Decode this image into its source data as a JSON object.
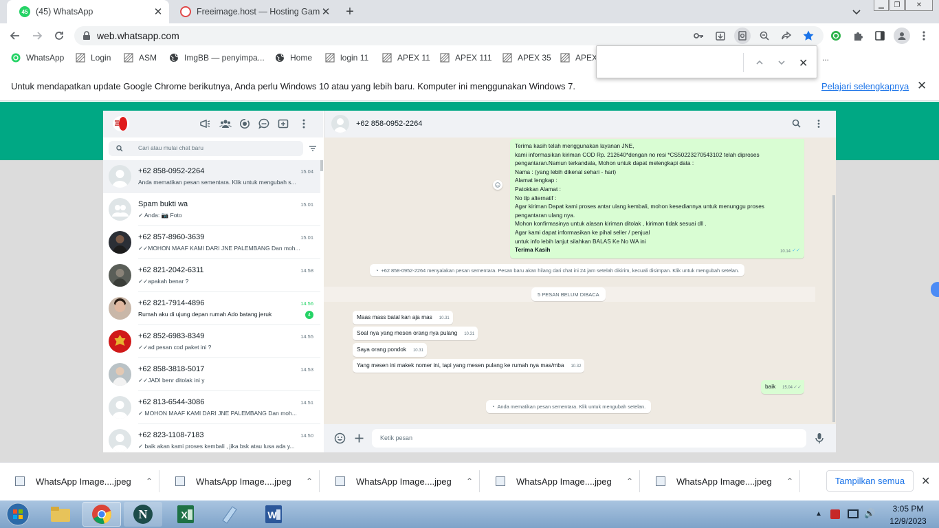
{
  "browser": {
    "tabs": [
      {
        "title": "(45) WhatsApp",
        "badge": "45"
      },
      {
        "title": "Freeimage.host — Hosting Gamb"
      }
    ],
    "url": "web.whatsapp.com",
    "bookmarks": [
      "WhatsApp",
      "Login",
      "ASM",
      "ImgBB — penyimpa...",
      "Home",
      "login 11",
      "APEX 11",
      "APEX 111",
      "APEX 35",
      "APEX"
    ],
    "bookmark_overflow": "..."
  },
  "findbar": {
    "value": ""
  },
  "infobar": {
    "message": "Untuk mendapatkan update Google Chrome berikutnya, Anda perlu Windows 10 atau yang lebih baru. Komputer ini menggunakan Windows 7.",
    "link": "Pelajari selengkapnya"
  },
  "whatsapp": {
    "search_placeholder": "Cari atau mulai chat baru",
    "chats": [
      {
        "name": "+62 858-0952-2264",
        "time": "15.04",
        "preview": "Anda mematikan pesan sementara. Klik untuk mengubah s..."
      },
      {
        "name": "Spam bukti wa",
        "time": "15.01",
        "preview": "✓ Anda: 📷 Foto"
      },
      {
        "name": "+62 857-8960-3639",
        "time": "15.01",
        "preview": "✓✓MOHON MAAF KAMI DARI JNE PALEMBANG   Dan moh..."
      },
      {
        "name": "+62 821-2042-6311",
        "time": "14.58",
        "preview": "✓✓apakah benar  ?"
      },
      {
        "name": "+62 821-7914-4896",
        "time": "14.56",
        "preview": "Rumah aku di ujung depan rumah Ado batang jeruk",
        "unread": "4"
      },
      {
        "name": "+62 852-6983-8349",
        "time": "14.55",
        "preview": "✓✓ad pesan cod  paket ini ?"
      },
      {
        "name": "+62 858-3818-5017",
        "time": "14.53",
        "preview": "✓✓JADI benr ditolak ini y"
      },
      {
        "name": "+62 813-6544-3086",
        "time": "14.51",
        "preview": "✓ MOHON MAAF KAMI DARI JNE PALEMBANG   Dan moh..."
      },
      {
        "name": "+62 823-1108-7183",
        "time": "14.50",
        "preview": "✓ baik akan kami proses kembali , jika bsk atau lusa ada  y..."
      }
    ],
    "conversation": {
      "contact": "+62 858-0952-2264",
      "outgoing_long": {
        "lines": [
          "Terima kasih telah menggunakan layanan JNE,",
          "kami informasikan kiriman COD  Rp. 212640*dengan no resi *CS50223270543102 telah diproses",
          "pengantaran.Namun terkandala, Mohon untuk dapat melengkapi data :",
          "Nama : (yang lebih dikenal sehari - hari)",
          "Alamat  lengkap :",
          "Patokkan Alamat :",
          "No tlp alternatif :",
          "Agar kiriman Dapat kami proses antar ulang kembali, mohon kesediannya untuk menunggu proses",
          "pengantaran ulang nya.",
          "Mohon konfirmasinya untuk alasan kiriman ditolak , kiriman tidak sesuai dll .",
          "Agar kami dapat informasikan ke pihal seller / penjual",
          "untuk info lebih lanjut silahkan BALAS Ke No WA ini",
          "Terima Kasih"
        ],
        "time": "10.14"
      },
      "system_disappearing_on": "+62 858-0952-2264 menyalakan pesan sementara. Pesan baru akan hilang dari chat ini 24 jam setelah dikirim, kecuali disimpan. Klik untuk mengubah setelan.",
      "unread_divider": "5 PESAN BELUM DIBACA",
      "incoming": [
        {
          "text": "Maas mass batal kan aja mas",
          "time": "10.31"
        },
        {
          "text": "Soal nya yang mesen orang nya pulang",
          "time": "10.31"
        },
        {
          "text": "Saya orang pondok",
          "time": "10.31"
        },
        {
          "text": "Yang mesen ini makek nomer ini, tapi yang mesen pulang ke rumah nya mas/mba",
          "time": "10.32"
        }
      ],
      "outgoing_short": {
        "text": "baik",
        "time": "15.04"
      },
      "system_disappearing_off": "Anda mematikan pesan sementara. Klik untuk mengubah setelan.",
      "composer_placeholder": "Ketik pesan"
    }
  },
  "downloads": {
    "items": [
      "WhatsApp Image....jpeg",
      "WhatsApp Image....jpeg",
      "WhatsApp Image....jpeg",
      "WhatsApp Image....jpeg",
      "WhatsApp Image....jpeg"
    ],
    "show_all": "Tampilkan semua"
  },
  "taskbar": {
    "time": "3:05 PM",
    "date": "12/9/2023"
  },
  "colors": {
    "wa_green": "#00a884",
    "out_bubble": "#d9fdd3",
    "unread_green": "#25d366",
    "chrome_blue": "#1a73e8"
  }
}
